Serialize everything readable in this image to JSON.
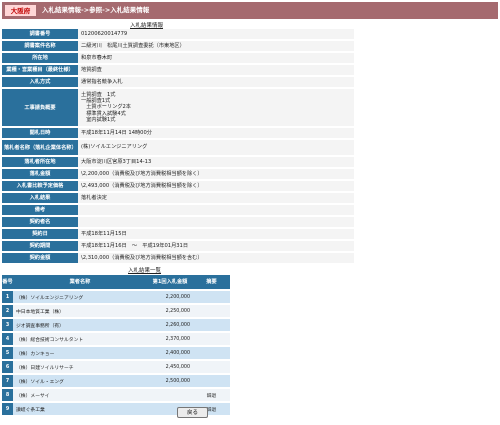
{
  "header": {
    "badge": "大阪府",
    "breadcrumb": "入札結果情報->参照->入札結果情報"
  },
  "detail_section": {
    "title": "入札結果情報",
    "rows": [
      {
        "label": "調書番号",
        "value": "01200620014779"
      },
      {
        "label": "調書案件名称",
        "value": "二級河川　松尾川土質調査委託（市東地区）"
      },
      {
        "label": "所在地",
        "value": "和泉市春木町"
      },
      {
        "label": "業種・営業種目（最終仕様）",
        "value": "地質調査"
      },
      {
        "label": "入札方式",
        "value": "通常指名競争入札"
      },
      {
        "label": "工事請負概要",
        "lines": [
          "土質調査　1式",
          "一般調査1式",
          "　土質ボーリング2本",
          "　標準貫入試験4式",
          "　室内試験1式"
        ]
      },
      {
        "label": "開札日時",
        "value": "平成18年11月14日 14時00分"
      },
      {
        "label": "落札者名称（落札企業体名称）",
        "value": "(株)ソイルエンジニアリング"
      },
      {
        "label": "落札者所在地",
        "value": "大阪市淀川区宮原3丁目14-13"
      },
      {
        "label": "落札金額",
        "value": "\\2,200,000（消費税及び地方消費税相当額を除く）"
      },
      {
        "label": "入札書比較予定価格",
        "value": "\\2,493,000（消費税及び地方消費税相当額を除く）"
      },
      {
        "label": "入札結果",
        "value": "落札者決定"
      },
      {
        "label": "備考",
        "value": ""
      },
      {
        "label": "契約者名",
        "value": ""
      },
      {
        "label": "契約日",
        "value": "平成18年11月15日"
      },
      {
        "label": "契約期間",
        "value": "平成18年11月16日　～　平成19年01月31日"
      },
      {
        "label": "契約金額",
        "value": "\\2,310,000（消費税及び地方消費税相当額を含む）"
      }
    ]
  },
  "result_list": {
    "title": "入札結果一覧",
    "headers": [
      "番号",
      "業者名称",
      "第1回入札金額",
      "摘要"
    ],
    "rows": [
      {
        "no": "1",
        "name": "（株）ソイルエンジニアリング",
        "amount": "2,200,000",
        "remark": ""
      },
      {
        "no": "2",
        "name": "中日本地質工業（株）",
        "amount": "2,250,000",
        "remark": ""
      },
      {
        "no": "3",
        "name": "ジオ調査事務所（有）",
        "amount": "2,260,000",
        "remark": ""
      },
      {
        "no": "4",
        "name": "（株）総合技術コンサルタント",
        "amount": "2,370,000",
        "remark": ""
      },
      {
        "no": "5",
        "name": "（株）カンキョー",
        "amount": "2,400,000",
        "remark": ""
      },
      {
        "no": "6",
        "name": "（株）日建ソイルリサーチ",
        "amount": "2,450,000",
        "remark": ""
      },
      {
        "no": "7",
        "name": "（株）ソイル・エング",
        "amount": "2,500,000",
        "remark": ""
      },
      {
        "no": "8",
        "name": "（株）メーサイ",
        "amount": "",
        "remark": "辞退"
      },
      {
        "no": "9",
        "name": "讃岐ぐ条工業",
        "amount": "",
        "remark": "辞退"
      }
    ]
  },
  "footer": {
    "back_label": "戻る"
  }
}
